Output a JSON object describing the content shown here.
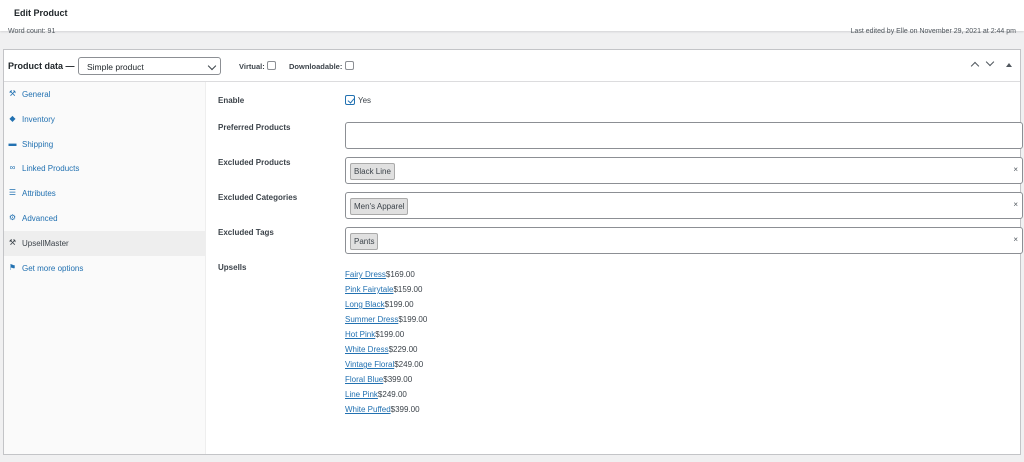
{
  "page": {
    "title": "Edit Product",
    "word_count": "Word count: 91",
    "last_edited": "Last edited by Elle on November 29, 2021 at 2:44 pm"
  },
  "product_data": {
    "label": "Product data —",
    "type_selected": "Simple product",
    "virtual_label": "Virtual:",
    "virtual_checked": false,
    "downloadable_label": "Downloadable:",
    "downloadable_checked": false
  },
  "tabs": [
    {
      "label": "General",
      "icon": "wrench-icon",
      "active": false
    },
    {
      "label": "Inventory",
      "icon": "tag-icon",
      "active": false
    },
    {
      "label": "Shipping",
      "icon": "truck-icon",
      "active": false
    },
    {
      "label": "Linked Products",
      "icon": "link-icon",
      "active": false
    },
    {
      "label": "Attributes",
      "icon": "list-icon",
      "active": false
    },
    {
      "label": "Advanced",
      "icon": "gear-icon",
      "active": false
    },
    {
      "label": "UpsellMaster",
      "icon": "wrench-icon",
      "active": true
    },
    {
      "label": "Get more options",
      "icon": "plugin-icon",
      "active": false
    }
  ],
  "form": {
    "enable_label": "Enable",
    "enable_value": "Yes",
    "enable_checked": true,
    "preferred_label": "Preferred Products",
    "excluded_products_label": "Excluded Products",
    "excluded_products": [
      "Black Line"
    ],
    "excluded_categories_label": "Excluded Categories",
    "excluded_categories": [
      "Men's Apparel"
    ],
    "excluded_tags_label": "Excluded Tags",
    "excluded_tags": [
      "Pants"
    ],
    "upsells_label": "Upsells",
    "clear_symbol": "×"
  },
  "upsells": [
    {
      "name": "Fairy Dress",
      "price": "$169.00"
    },
    {
      "name": "Pink Fairytale",
      "price": "$159.00"
    },
    {
      "name": "Long Black",
      "price": "$199.00"
    },
    {
      "name": "Summer Dress",
      "price": "$199.00"
    },
    {
      "name": "Hot Pink",
      "price": "$199.00"
    },
    {
      "name": "White Dress",
      "price": "$229.00"
    },
    {
      "name": "Vintage Floral",
      "price": "$249.00"
    },
    {
      "name": "Floral Blue",
      "price": "$399.00"
    },
    {
      "name": "Line Pink",
      "price": "$249.00"
    },
    {
      "name": "White Puffed",
      "price": "$399.00"
    }
  ],
  "colors": {
    "link": "#2271b1",
    "text": "#3c434a",
    "panel_border": "#c3c4c7"
  }
}
